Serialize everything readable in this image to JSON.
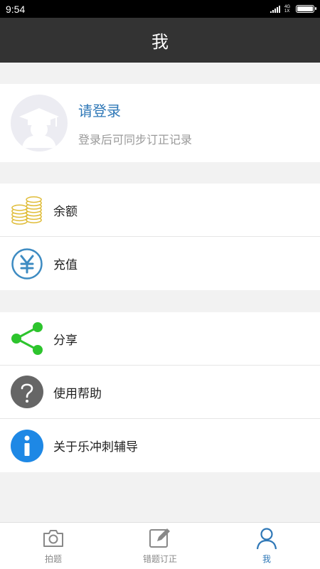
{
  "status_bar": {
    "time": "9:54",
    "network_label": "4G 1X"
  },
  "header": {
    "title": "我"
  },
  "profile": {
    "login_label": "请登录",
    "login_hint": "登录后可同步订正记录"
  },
  "menu_group_1": [
    {
      "label": "余额",
      "icon": "coins-icon"
    },
    {
      "label": "充值",
      "icon": "yuan-icon"
    }
  ],
  "menu_group_2": [
    {
      "label": "分享",
      "icon": "share-icon"
    },
    {
      "label": "使用帮助",
      "icon": "help-icon"
    },
    {
      "label": "关于乐冲刺辅导",
      "icon": "info-icon"
    }
  ],
  "tabs": [
    {
      "label": "拍题",
      "icon": "camera-icon",
      "active": false
    },
    {
      "label": "错题订正",
      "icon": "edit-icon",
      "active": false
    },
    {
      "label": "我",
      "icon": "user-icon",
      "active": true
    }
  ],
  "colors": {
    "accent": "#2f78b7",
    "header_bg": "#333333",
    "share_green": "#2dc42d",
    "info_blue": "#1e88e5",
    "help_gray": "#666666",
    "coin_gold": "#e8c84a"
  }
}
